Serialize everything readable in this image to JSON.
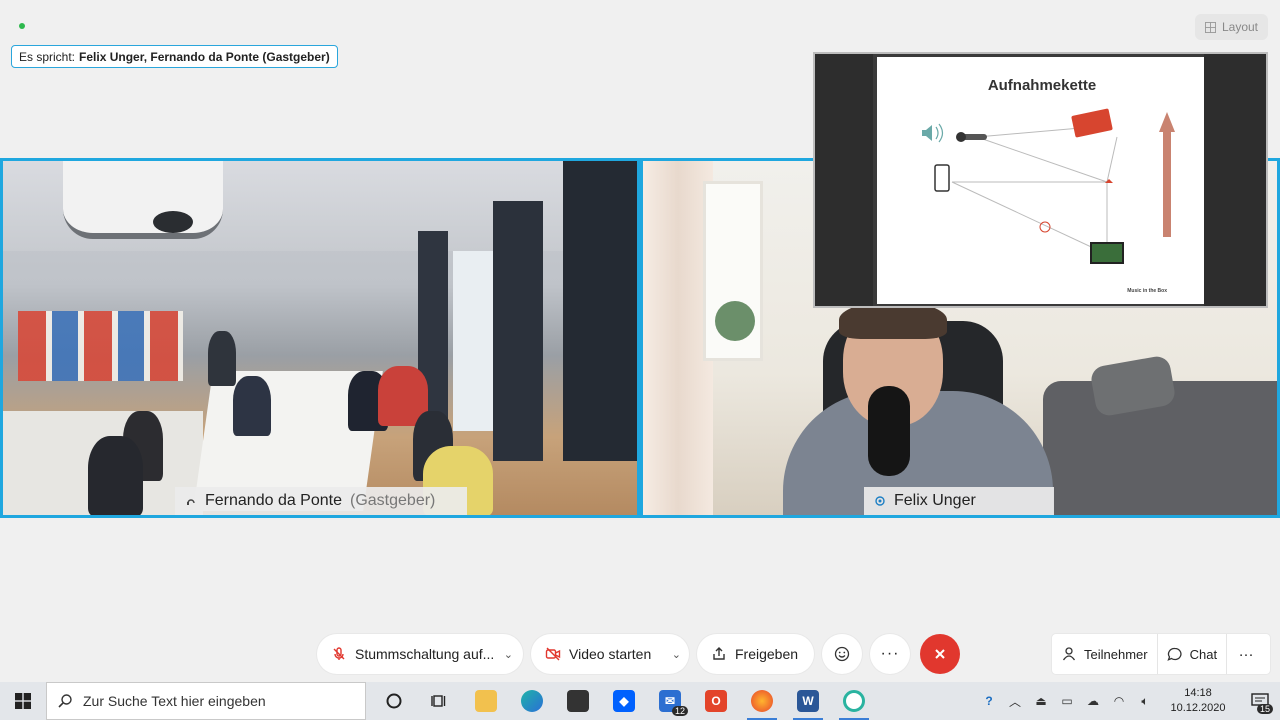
{
  "header": {
    "layout_label": "Layout",
    "speaking_prefix": "Es spricht:",
    "speaking_names": "Felix Unger, Fernando da Ponte (Gastgeber)"
  },
  "participants": [
    {
      "name": "Fernando da Ponte",
      "role": "(Gastgeber)"
    },
    {
      "name": "Felix Unger",
      "role": ""
    }
  ],
  "shared_screen": {
    "slide_title": "Aufnahmekette",
    "footer": "Music in the Box"
  },
  "controls": {
    "mute_label": "Stummschaltung auf...",
    "video_label": "Video starten",
    "share_label": "Freigeben",
    "participants_label": "Teilnehmer",
    "chat_label": "Chat",
    "more_label": "···"
  },
  "taskbar": {
    "search_placeholder": "Zur Suche Text hier eingeben",
    "mail_badge": "12",
    "time": "14:18",
    "date": "10.12.2020",
    "notification_count": "15"
  },
  "colors": {
    "accent": "#1fa7df",
    "leave": "#e1372e",
    "speaking_dot": "#2db84d"
  }
}
